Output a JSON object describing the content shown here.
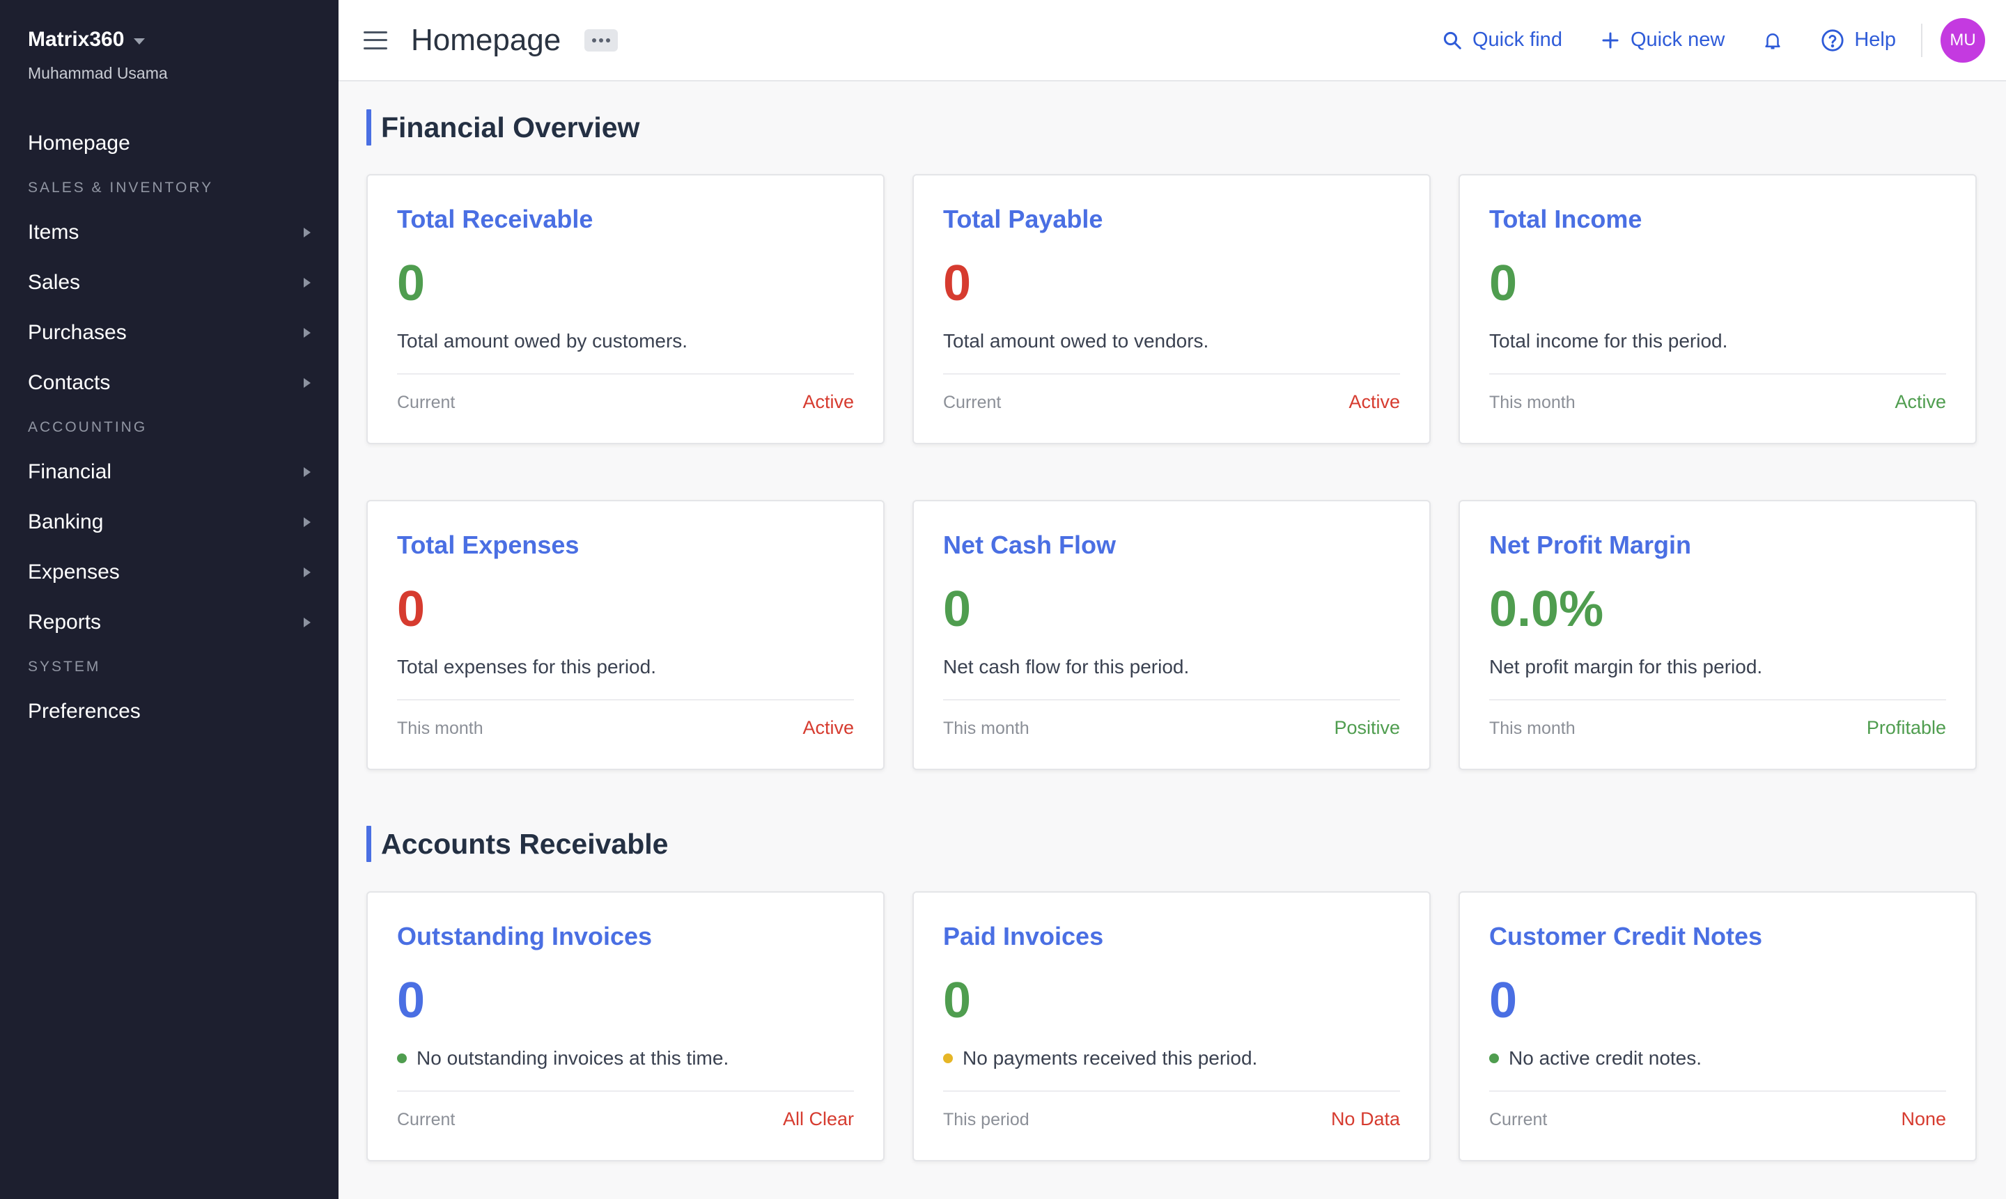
{
  "sidebar": {
    "brand": "Matrix360",
    "user": "Muhammad Usama",
    "homepage": "Homepage",
    "sections": {
      "sales": "SALES & INVENTORY",
      "accounting": "ACCOUNTING",
      "system": "SYSTEM"
    },
    "items": {
      "items": "Items",
      "sales": "Sales",
      "purchases": "Purchases",
      "contacts": "Contacts",
      "financial": "Financial",
      "banking": "Banking",
      "expenses": "Expenses",
      "reports": "Reports",
      "preferences": "Preferences"
    }
  },
  "header": {
    "title": "Homepage",
    "quick_find": "Quick find",
    "quick_new": "Quick new",
    "help": "Help",
    "avatar_initials": "MU"
  },
  "sections": {
    "financial_overview": "Financial Overview",
    "accounts_receivable": "Accounts Receivable"
  },
  "colors": {
    "accent": "#4a6fe3",
    "green": "#4f9d4f",
    "red": "#d63b2f",
    "amber": "#e6b626",
    "sidebar_bg": "#1d1f2f",
    "avatar_bg": "#c43ae0"
  },
  "cards": [
    {
      "title": "Total Receivable",
      "value": "0",
      "desc": "Total amount owed by customers.",
      "period": "Current",
      "status": "Active"
    },
    {
      "title": "Total Payable",
      "value": "0",
      "desc": "Total amount owed to vendors.",
      "period": "Current",
      "status": "Active"
    },
    {
      "title": "Total Income",
      "value": "0",
      "desc": "Total income for this period.",
      "period": "This month",
      "status": "Active"
    },
    {
      "title": "Total Expenses",
      "value": "0",
      "desc": "Total expenses for this period.",
      "period": "This month",
      "status": "Active"
    },
    {
      "title": "Net Cash Flow",
      "value": "0",
      "desc": "Net cash flow for this period.",
      "period": "This month",
      "status": "Positive"
    },
    {
      "title": "Net Profit Margin",
      "value": "0.0%",
      "desc": "Net profit margin for this period.",
      "period": "This month",
      "status": "Profitable"
    },
    {
      "title": "Outstanding Invoices",
      "value": "0",
      "desc": "No outstanding invoices at this time.",
      "period": "Current",
      "status": "All Clear"
    },
    {
      "title": "Paid Invoices",
      "value": "0",
      "desc": "No payments received this period.",
      "period": "This period",
      "status": "No Data"
    },
    {
      "title": "Customer Credit Notes",
      "value": "0",
      "desc": "No active credit notes.",
      "period": "Current",
      "status": "None"
    }
  ]
}
